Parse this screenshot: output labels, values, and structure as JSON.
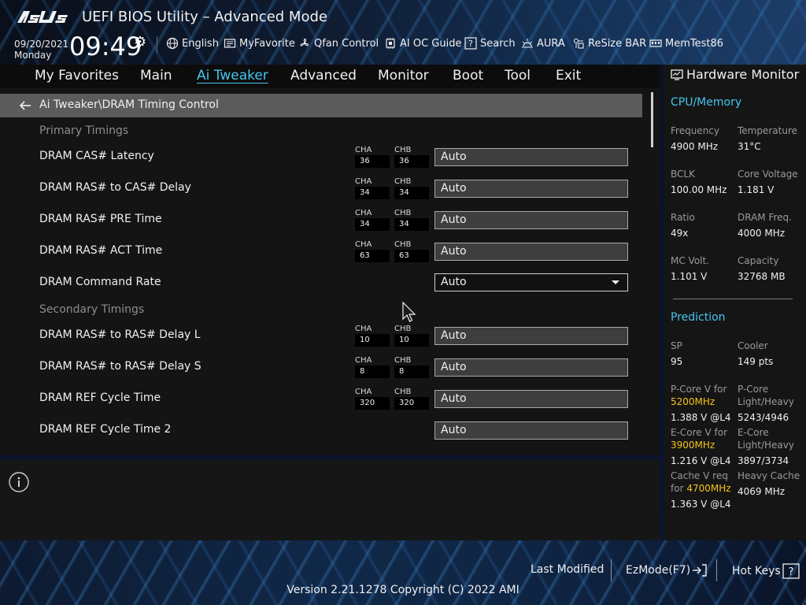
{
  "header": {
    "brand": "ASUS",
    "title": "UEFI BIOS Utility – Advanced Mode",
    "date": "09/20/2021",
    "day": "Monday",
    "time": "09:49"
  },
  "toolbar": [
    {
      "label": "English",
      "icon": "globe-icon"
    },
    {
      "label": "MyFavorite",
      "icon": "favorite-list-icon"
    },
    {
      "label": "Qfan Control",
      "icon": "fan-icon"
    },
    {
      "label": "AI OC Guide",
      "icon": "ai-chip-icon"
    },
    {
      "label": "Search",
      "icon": "question-icon"
    },
    {
      "label": "AURA",
      "icon": "aura-light-icon"
    },
    {
      "label": "ReSize BAR",
      "icon": "resize-bar-icon"
    },
    {
      "label": "MemTest86",
      "icon": "memory-icon"
    }
  ],
  "menu": [
    {
      "label": "My Favorites",
      "active": false
    },
    {
      "label": "Main",
      "active": false
    },
    {
      "label": "Ai Tweaker",
      "active": true
    },
    {
      "label": "Advanced",
      "active": false
    },
    {
      "label": "Monitor",
      "active": false
    },
    {
      "label": "Boot",
      "active": false
    },
    {
      "label": "Tool",
      "active": false
    },
    {
      "label": "Exit",
      "active": false
    }
  ],
  "breadcrumb": "Ai Tweaker\\DRAM Timing Control",
  "sections": {
    "primary": "Primary Timings",
    "secondary": "Secondary Timings"
  },
  "rows": [
    {
      "label": "DRAM CAS# Latency",
      "cha_label": "CHA",
      "chb_label": "CHB",
      "cha": "36",
      "chb": "36",
      "value": "Auto"
    },
    {
      "label": "DRAM RAS# to CAS# Delay",
      "cha_label": "CHA",
      "chb_label": "CHB",
      "cha": "34",
      "chb": "34",
      "value": "Auto"
    },
    {
      "label": "DRAM RAS# PRE Time",
      "cha_label": "CHA",
      "chb_label": "CHB",
      "cha": "34",
      "chb": "34",
      "value": "Auto"
    },
    {
      "label": "DRAM RAS# ACT Time",
      "cha_label": "CHA",
      "chb_label": "CHB",
      "cha": "63",
      "chb": "63",
      "value": "Auto"
    },
    {
      "label": "DRAM Command Rate",
      "value": "Auto"
    },
    {
      "label": "DRAM RAS# to RAS# Delay L",
      "cha_label": "CHA",
      "chb_label": "CHB",
      "cha": "10",
      "chb": "10",
      "value": "Auto"
    },
    {
      "label": "DRAM RAS# to RAS# Delay S",
      "cha_label": "CHA",
      "chb_label": "CHB",
      "cha": "8",
      "chb": "8",
      "value": "Auto"
    },
    {
      "label": "DRAM REF Cycle Time",
      "cha_label": "CHA",
      "chb_label": "CHB",
      "cha": "320",
      "chb": "320",
      "value": "Auto"
    },
    {
      "label": "DRAM REF Cycle Time 2",
      "value": "Auto"
    }
  ],
  "hw_monitor": {
    "title": "Hardware Monitor",
    "cpu_memory_heading": "CPU/Memory",
    "frequency_label": "Frequency",
    "frequency": "4900 MHz",
    "temperature_label": "Temperature",
    "temperature": "31°C",
    "bclk_label": "BCLK",
    "bclk": "100.00 MHz",
    "core_voltage_label": "Core Voltage",
    "core_voltage": "1.181 V",
    "ratio_label": "Ratio",
    "ratio": "49x",
    "dram_freq_label": "DRAM Freq.",
    "dram_freq": "4000 MHz",
    "mc_volt_label": "MC Volt.",
    "mc_volt": "1.101 V",
    "capacity_label": "Capacity",
    "capacity": "32768 MB",
    "prediction_heading": "Prediction",
    "sp_label": "SP",
    "sp": "95",
    "cooler_label": "Cooler",
    "cooler": "149 pts",
    "pcore_v_label": "P-Core V for",
    "pcore_v_freq": "5200MHz",
    "pcore_v": "1.388 V @L4",
    "pcore_lh_label1": "P-Core",
    "pcore_lh_label2": "Light/Heavy",
    "pcore_lh": "5243/4946",
    "ecore_v_label": "E-Core V for",
    "ecore_v_freq": "3900MHz",
    "ecore_v": "1.216 V @L4",
    "ecore_lh_label1": "E-Core",
    "ecore_lh_label2": "Light/Heavy",
    "ecore_lh": "3897/3734",
    "cache_v_label": "Cache V req",
    "cache_v_for": "for",
    "cache_v_freq": "4700MHz",
    "cache_v": "1.363 V @L4",
    "heavy_cache_label": "Heavy Cache",
    "heavy_cache": "4069 MHz"
  },
  "footer": {
    "last_modified": "Last Modified",
    "ezmode": "EzMode(F7)",
    "hot_keys": "Hot Keys",
    "version": "Version 2.21.1278 Copyright (C) 2022 AMI"
  },
  "colors": {
    "accent": "#44c6ee",
    "highlight": "#f5c518",
    "breadcrumb_bar": "#5b5b5b",
    "panel": "#141414"
  }
}
